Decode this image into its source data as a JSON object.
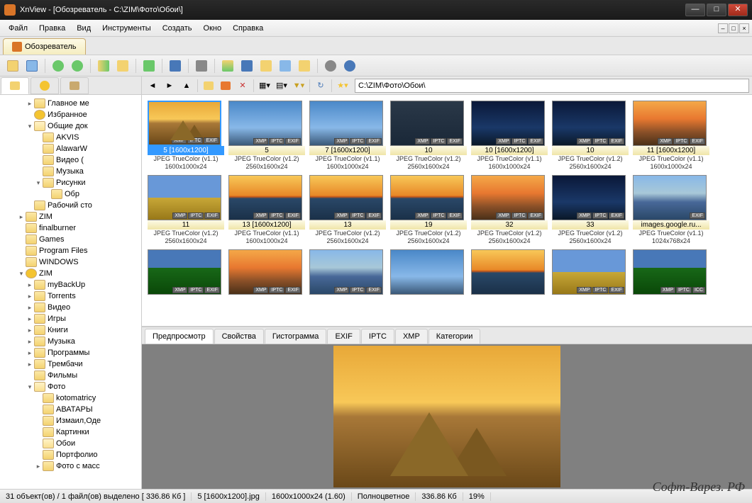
{
  "title": "XnView - [Обозреватель - C:\\ZIM\\Фото\\Обои\\]",
  "menu": [
    "Файл",
    "Правка",
    "Вид",
    "Инструменты",
    "Создать",
    "Окно",
    "Справка"
  ],
  "tab": "Обозреватель",
  "path": "C:\\ZIM\\Фото\\Обои\\",
  "tree": [
    {
      "l": "Главное ме",
      "d": 3,
      "e": "▸",
      "i": "f"
    },
    {
      "l": "Избранное",
      "d": 3,
      "e": "",
      "i": "star"
    },
    {
      "l": "Общие док",
      "d": 3,
      "e": "▾",
      "i": "open"
    },
    {
      "l": "AKVIS",
      "d": 4,
      "e": "",
      "i": "f"
    },
    {
      "l": "AlawarW",
      "d": 4,
      "e": "",
      "i": "f"
    },
    {
      "l": "Видео (",
      "d": 4,
      "e": "",
      "i": "f"
    },
    {
      "l": "Музыка",
      "d": 4,
      "e": "",
      "i": "f"
    },
    {
      "l": "Рисунки",
      "d": 4,
      "e": "▾",
      "i": "f"
    },
    {
      "l": "Обр",
      "d": 5,
      "e": "",
      "i": "f"
    },
    {
      "l": "Рабочий сто",
      "d": 3,
      "e": "",
      "i": "f"
    },
    {
      "l": "ZIM",
      "d": 2,
      "e": "▸",
      "i": "f"
    },
    {
      "l": "finalburner",
      "d": 2,
      "e": "",
      "i": "f"
    },
    {
      "l": "Games",
      "d": 2,
      "e": "",
      "i": "f"
    },
    {
      "l": "Program Files",
      "d": 2,
      "e": "",
      "i": "f"
    },
    {
      "l": "WINDOWS",
      "d": 2,
      "e": "",
      "i": "f"
    },
    {
      "l": "ZIM",
      "d": 2,
      "e": "▾",
      "i": "star"
    },
    {
      "l": "myBackUp",
      "d": 3,
      "e": "▸",
      "i": "f"
    },
    {
      "l": "Torrents",
      "d": 3,
      "e": "▸",
      "i": "f"
    },
    {
      "l": "Видео",
      "d": 3,
      "e": "▸",
      "i": "f"
    },
    {
      "l": "Игры",
      "d": 3,
      "e": "▸",
      "i": "f"
    },
    {
      "l": "Книги",
      "d": 3,
      "e": "▸",
      "i": "f"
    },
    {
      "l": "Музыка",
      "d": 3,
      "e": "▸",
      "i": "f"
    },
    {
      "l": "Программы",
      "d": 3,
      "e": "▸",
      "i": "f"
    },
    {
      "l": "Трембачи",
      "d": 3,
      "e": "▸",
      "i": "f"
    },
    {
      "l": "Фильмы",
      "d": 3,
      "e": "",
      "i": "f"
    },
    {
      "l": "Фото",
      "d": 3,
      "e": "▾",
      "i": "open"
    },
    {
      "l": "kotomatricy",
      "d": 4,
      "e": "",
      "i": "f"
    },
    {
      "l": "АВАТАРЫ",
      "d": 4,
      "e": "",
      "i": "f"
    },
    {
      "l": "Измаил,Оде",
      "d": 4,
      "e": "",
      "i": "f"
    },
    {
      "l": "Картинки",
      "d": 4,
      "e": "",
      "i": "f"
    },
    {
      "l": "Обои",
      "d": 4,
      "e": "",
      "i": "open"
    },
    {
      "l": "Портфолио",
      "d": 4,
      "e": "",
      "i": "f"
    },
    {
      "l": "Фото с масс",
      "d": 4,
      "e": "▸",
      "i": "f"
    }
  ],
  "thumbs": [
    [
      {
        "n": "5 [1600x1200]",
        "t": "JPEG TrueColor (v1.1)",
        "d": "1600x1000x24",
        "c": "pyramid",
        "sel": true,
        "b": [
          "XMP",
          "IPTC",
          "EXIF"
        ]
      },
      {
        "n": "5",
        "t": "JPEG TrueColor (v1.2)",
        "d": "2560x1600x24",
        "c": "sky-blue",
        "b": [
          "XMP",
          "IPTC",
          "EXIF"
        ]
      },
      {
        "n": "7 [1600x1200]",
        "t": "JPEG TrueColor (v1.1)",
        "d": "1600x1000x24",
        "c": "sky-blue",
        "b": [
          "XMP",
          "IPTC",
          "EXIF"
        ]
      },
      {
        "n": "10",
        "t": "JPEG TrueColor (v1.2)",
        "d": "2560x1600x24",
        "c": "sky-dark",
        "b": [
          "XMP",
          "IPTC",
          "EXIF"
        ]
      },
      {
        "n": "10 [1600x1200]",
        "t": "JPEG TrueColor (v1.1)",
        "d": "1600x1000x24",
        "c": "sky-night",
        "b": [
          "XMP",
          "IPTC",
          "EXIF"
        ]
      },
      {
        "n": "10",
        "t": "JPEG TrueColor (v1.2)",
        "d": "2560x1600x24",
        "c": "sky-night",
        "b": [
          "XMP",
          "IPTC",
          "EXIF"
        ]
      },
      {
        "n": "11 [1600x1200]",
        "t": "JPEG TrueColor (v1.1)",
        "d": "1600x1000x24",
        "c": "sky-sunset",
        "b": [
          "XMP",
          "IPTC",
          "EXIF"
        ]
      }
    ],
    [
      {
        "n": "11",
        "t": "JPEG TrueColor (v1.2)",
        "d": "2560x1600x24",
        "c": "field",
        "b": [
          "XMP",
          "IPTC",
          "EXIF"
        ]
      },
      {
        "n": "13 [1600x1200]",
        "t": "JPEG TrueColor (v1.1)",
        "d": "1600x1000x24",
        "c": "ocean-sun",
        "b": [
          "XMP",
          "IPTC",
          "EXIF"
        ]
      },
      {
        "n": "13",
        "t": "JPEG TrueColor (v1.2)",
        "d": "2560x1600x24",
        "c": "ocean-sun",
        "b": [
          "XMP",
          "IPTC",
          "EXIF"
        ]
      },
      {
        "n": "19",
        "t": "JPEG TrueColor (v1.2)",
        "d": "2560x1600x24",
        "c": "ocean-sun",
        "b": [
          "XMP",
          "IPTC",
          "EXIF"
        ]
      },
      {
        "n": "32",
        "t": "JPEG TrueColor (v1.2)",
        "d": "2560x1600x24",
        "c": "sky-sunset",
        "b": [
          "XMP",
          "IPTC",
          "EXIF"
        ]
      },
      {
        "n": "33",
        "t": "JPEG TrueColor (v1.2)",
        "d": "2560x1600x24",
        "c": "sky-night",
        "b": [
          "XMP",
          "IPTC",
          "EXIF"
        ]
      },
      {
        "n": "images.google.ru...",
        "t": "JPEG TrueColor (v1.1)",
        "d": "1024x768x24",
        "c": "lake",
        "b": [
          "EXIF"
        ]
      }
    ],
    [
      {
        "n": "",
        "t": "",
        "d": "",
        "c": "green",
        "b": [
          "XMP",
          "IPTC",
          "EXIF"
        ]
      },
      {
        "n": "",
        "t": "",
        "d": "",
        "c": "sky-sunset",
        "b": [
          "XMP",
          "IPTC",
          "EXIF"
        ]
      },
      {
        "n": "",
        "t": "",
        "d": "",
        "c": "lake",
        "b": [
          "XMP",
          "IPTC",
          "EXIF"
        ]
      },
      {
        "n": "",
        "t": "",
        "d": "",
        "c": "sky-blue",
        "b": []
      },
      {
        "n": "",
        "t": "",
        "d": "",
        "c": "ocean-sun",
        "b": []
      },
      {
        "n": "",
        "t": "",
        "d": "",
        "c": "field",
        "b": [
          "XMP",
          "IPTC",
          "EXIF"
        ]
      },
      {
        "n": "",
        "t": "",
        "d": "",
        "c": "green",
        "b": [
          "XMP",
          "IPTC",
          "ICC"
        ]
      }
    ]
  ],
  "ptabs": [
    "Предпросмотр",
    "Свойства",
    "Гистограмма",
    "EXIF",
    "IPTC",
    "XMP",
    "Категории"
  ],
  "status": [
    "31 объект(ов) / 1 файл(ов) выделено [ 336.86 Кб ]",
    "5 [1600x1200].jpg",
    "1600x1000x24 (1.60)",
    "Полноцветное",
    "336.86 Кб",
    "19%"
  ],
  "watermark": "Софт-Варез. РФ"
}
